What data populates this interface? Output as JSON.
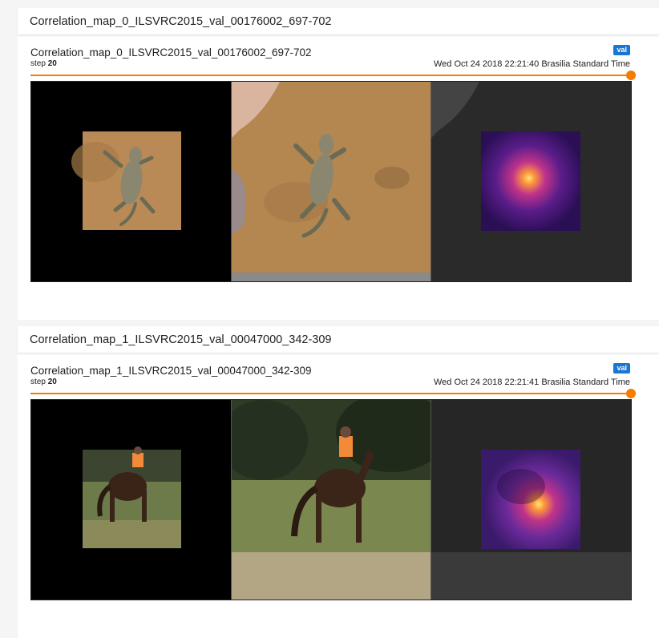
{
  "cards": [
    {
      "header_title": "Correlation_map_0_ILSVRC2015_val_00176002_697-702",
      "run_title": "Correlation_map_0_ILSVRC2015_val_00176002_697-702",
      "step_label": "step",
      "step_value": "20",
      "badge": "val",
      "timestamp": "Wed Oct 24 2018 22:21:40 Brasilia Standard Time",
      "accent_color": "#f57c00"
    },
    {
      "header_title": "Correlation_map_1_ILSVRC2015_val_00047000_342-309",
      "run_title": "Correlation_map_1_ILSVRC2015_val_00047000_342-309",
      "step_label": "step",
      "step_value": "20",
      "badge": "val",
      "timestamp": "Wed Oct 24 2018 22:21:41 Brasilia Standard Time",
      "accent_color": "#f57c00"
    }
  ]
}
